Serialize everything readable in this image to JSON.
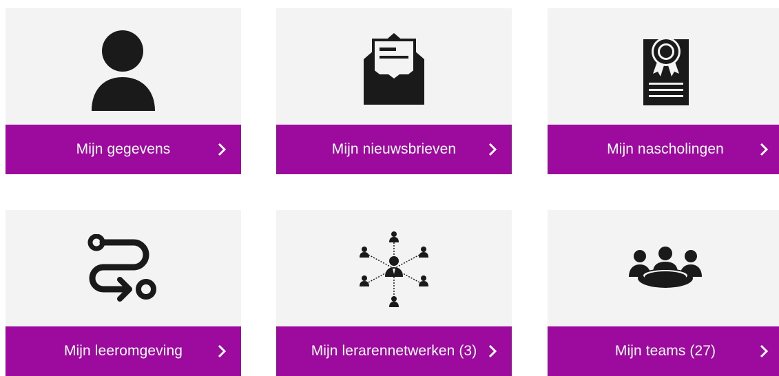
{
  "tiles": [
    {
      "label": "Mijn gegevens",
      "icon": "user-icon"
    },
    {
      "label": "Mijn nieuwsbrieven",
      "icon": "newsletter-envelope-icon"
    },
    {
      "label": "Mijn nascholingen",
      "icon": "certificate-icon"
    },
    {
      "label": "Mijn leeromgeving",
      "icon": "learning-path-icon"
    },
    {
      "label": "Mijn lerarennetwerken (3)",
      "icon": "network-icon"
    },
    {
      "label": "Mijn teams (27)",
      "icon": "team-meeting-icon"
    }
  ],
  "colors": {
    "tile_background": "#f3f3f3",
    "bar_background": "#9c0a9e",
    "bar_text": "#ffffff",
    "icon": "#1a1a1a"
  }
}
